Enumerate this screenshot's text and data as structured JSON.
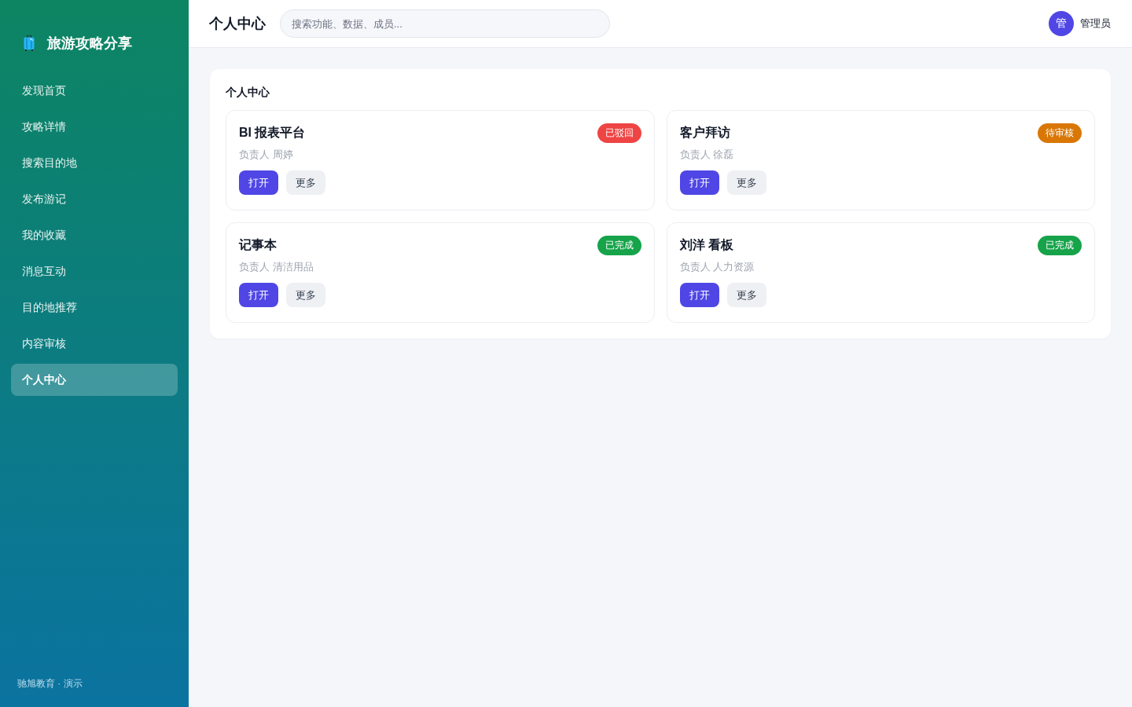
{
  "sidebar": {
    "brand": "旅游攻略分享",
    "items": [
      {
        "label": "发现首页",
        "selected": false
      },
      {
        "label": "攻略详情",
        "selected": false
      },
      {
        "label": "搜索目的地",
        "selected": false
      },
      {
        "label": "发布游记",
        "selected": false
      },
      {
        "label": "我的收藏",
        "selected": false
      },
      {
        "label": "消息互动",
        "selected": false
      },
      {
        "label": "目的地推荐",
        "selected": false
      },
      {
        "label": "内容审核",
        "selected": false
      },
      {
        "label": "个人中心",
        "selected": true
      }
    ],
    "footer": "驰旭教育 · 演示"
  },
  "header": {
    "title": "个人中心",
    "search": {
      "placeholder": "搜索功能、数据、成员..."
    },
    "user": {
      "avatar": "管",
      "name": "管理员"
    }
  },
  "panel": {
    "title": "个人中心",
    "cards": [
      {
        "title": "BI 报表平台",
        "status": {
          "label": "已驳回",
          "color": "#ef4444"
        },
        "owner": "负责人 周婷",
        "buttons": [
          "打开",
          "更多"
        ]
      },
      {
        "title": "客户拜访",
        "status": {
          "label": "待审核",
          "color": "#d97706"
        },
        "owner": "负责人 徐磊",
        "buttons": [
          "打开",
          "更多"
        ]
      },
      {
        "title": "记事本",
        "status": {
          "label": "已完成",
          "color": "#16a34a"
        },
        "owner": "负责人 清洁用品",
        "buttons": [
          "打开",
          "更多"
        ]
      },
      {
        "title": "刘洋 看板",
        "status": {
          "label": "已完成",
          "color": "#16a34a"
        },
        "owner": "负责人 人力资源",
        "buttons": [
          "打开",
          "更多"
        ]
      }
    ]
  }
}
